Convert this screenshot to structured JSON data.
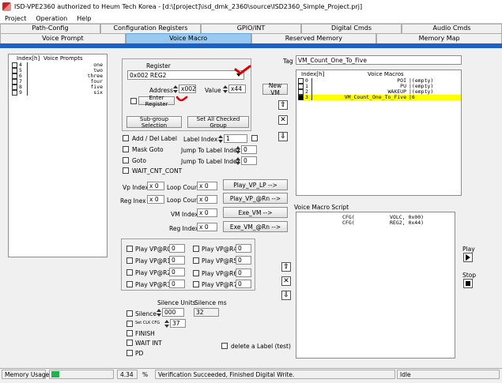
{
  "window": {
    "title": "ISD-VPE2360 authorized to Heum Tech Korea - [d:\\[project]\\isd_dmk_2360\\source\\ISD2360_Simple_Project.prj]"
  },
  "menu": [
    "Project",
    "Operation",
    "Help"
  ],
  "tabs_row1": [
    "Path-Config",
    "Configuration Registers",
    "GPIO/INT",
    "Digital Cmds",
    "Audio Cmds"
  ],
  "tabs_row2": [
    "Voice Prompt",
    "Voice Macro",
    "Reserved Memory",
    "Memory Map"
  ],
  "active_tab": "Voice Macro",
  "voice_prompts": {
    "header_index": "Index[h]",
    "header_name": "Voice Prompts",
    "rows": [
      {
        "index": "4",
        "name": "one"
      },
      {
        "index": "5",
        "name": "two"
      },
      {
        "index": "6",
        "name": "three"
      },
      {
        "index": "7",
        "name": "four"
      },
      {
        "index": "8",
        "name": "five"
      },
      {
        "index": "9",
        "name": "six"
      }
    ]
  },
  "register": {
    "group_label": "Register",
    "select_value": "0x002 REG2",
    "address_label": "Address",
    "address_value": "x002",
    "value_label": "Value",
    "value_value": "x44",
    "enter_register_label": "Enter Register",
    "subgroup_button": "Sub-group Selection",
    "set_all_button": "Set All Checked Group"
  },
  "options": {
    "add_del_label": "Add / Del Label",
    "label_index_label": "Label Index",
    "label_index_value": "1",
    "mask_goto": "Mask Goto",
    "jump_label_index_1": "Jump To Label Index",
    "jump_value_1": "0",
    "goto": "Goto",
    "jump_label_index_2": "Jump To Label Index",
    "jump_value_2": "0",
    "wait_cnt_cont": "WAIT_CNT_CONT"
  },
  "play": {
    "vp_index_label": "Vp Index",
    "vp_index_value": "x 0",
    "loop_count_label_1": "Loop Count",
    "loop_count_value_1": "x 0",
    "play_vp_lp_button": "Play_VP_LP -->",
    "reg_inex_label": "Reg Inex",
    "reg_inex_value": "x 0",
    "loop_count_label_2": "Loop Count",
    "loop_count_value_2": "x 0",
    "play_vp_rn_button": "Play_VP_@Rn -->",
    "vm_index_label": "VM Index",
    "vm_index_value": "x 0",
    "exe_vm_button": "Exe_VM -->",
    "reg_index_label": "Reg Index",
    "reg_index_value": "x 0",
    "exe_vm_rn_button": "Exe_VM_@Rn -->"
  },
  "play_vp_rows": [
    {
      "label": "Play VP@R0",
      "value": "0"
    },
    {
      "label": "Play VP@R4",
      "value": "0"
    },
    {
      "label": "Play VP@R1",
      "value": "0"
    },
    {
      "label": "Play VP@R5",
      "value": "0"
    },
    {
      "label": "Play VP@R2",
      "value": "0"
    },
    {
      "label": "Play VP@R6",
      "value": "0"
    },
    {
      "label": "Play VP@R3",
      "value": "0"
    },
    {
      "label": "Play VP@R7",
      "value": "0"
    }
  ],
  "silence": {
    "units_label": "Silence Units",
    "ms_label": "Silence ms",
    "silence_label": "Silence",
    "silence_value": "000",
    "silence_ms_value": "32",
    "set_clk_label": "Set CLK CFG",
    "set_clk_value": "37",
    "finish_label": "FINISH",
    "wait_int_label": "WAIT INT",
    "pd_label": "PD",
    "delete_label": "delete a Label (test)"
  },
  "macros": {
    "tag_label": "Tag",
    "tag_value": "VM_Count_One_To_Five",
    "new_vm_button": "New VM",
    "header_index": "Index[h]",
    "header_name": "Voice Macros",
    "rows": [
      {
        "index": "0",
        "name": "POI",
        "value": "|(empty)"
      },
      {
        "index": "1",
        "name": "PU",
        "value": "|(empty)"
      },
      {
        "index": "2",
        "name": "WAKEUP",
        "value": "|(empty)"
      },
      {
        "index": "3",
        "name": "VM_Count_One_To_Five",
        "value": "|6"
      }
    ],
    "selected_row": 3,
    "selected_color": "#ffff00"
  },
  "script": {
    "label": "Voice Macro Script",
    "rows": [
      {
        "cmd": "CFG(",
        "args": "VOLC, 0x00)"
      },
      {
        "cmd": "CFG(",
        "args": "REG2, 0x44)"
      }
    ]
  },
  "play_stop": {
    "play_label": "Play",
    "stop_label": "Stop"
  },
  "status": {
    "memory_usage_label": "Memory Usage",
    "memory_percent": "4.34",
    "percent_sign": "%",
    "memory_fill_fraction": 0.0434,
    "message": "Verification Succeeded, Finished Digital Write.",
    "state": "Idle"
  },
  "colors": {
    "accent_blue": "#1b62c4",
    "active_tab": "#99c9ef",
    "progress_green": "#22b14c",
    "annotation_red": "#e00000"
  },
  "icons": [
    "app-icon",
    "up-arrow-icon",
    "delete-x-icon",
    "down-arrow-icon",
    "play-icon",
    "stop-icon"
  ]
}
